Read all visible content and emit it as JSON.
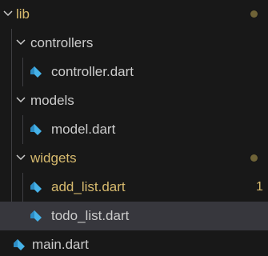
{
  "explorer": {
    "items": [
      {
        "label": "lib",
        "kind": "folder",
        "depth": 0,
        "expanded": true,
        "state": "modified",
        "decoration": "dot"
      },
      {
        "label": "controllers",
        "kind": "folder",
        "depth": 1,
        "expanded": true,
        "state": "normal"
      },
      {
        "label": "controller.dart",
        "kind": "file",
        "depth": 2,
        "icon": "dart-file-icon",
        "state": "normal"
      },
      {
        "label": "models",
        "kind": "folder",
        "depth": 1,
        "expanded": true,
        "state": "normal"
      },
      {
        "label": "model.dart",
        "kind": "file",
        "depth": 2,
        "icon": "dart-file-icon",
        "state": "normal"
      },
      {
        "label": "widgets",
        "kind": "folder",
        "depth": 1,
        "expanded": true,
        "state": "modified",
        "decoration": "dot"
      },
      {
        "label": "add_list.dart",
        "kind": "file",
        "depth": 2,
        "icon": "dart-file-icon",
        "state": "modified",
        "badge": "1"
      },
      {
        "label": "todo_list.dart",
        "kind": "file",
        "depth": 2,
        "icon": "dart-file-icon",
        "state": "normal",
        "selected": true
      },
      {
        "label": "main.dart",
        "kind": "file",
        "depth": 1,
        "icon": "dart-file-icon",
        "state": "normal"
      }
    ]
  },
  "colors": {
    "background": "#181818",
    "selected_row": "#37373d",
    "text": "#cccccc",
    "modified_text": "#d7ba6e",
    "modified_dot": "#6f6337",
    "dart_icon": "#46b2e8",
    "indent_guide": "#3e3e42"
  }
}
